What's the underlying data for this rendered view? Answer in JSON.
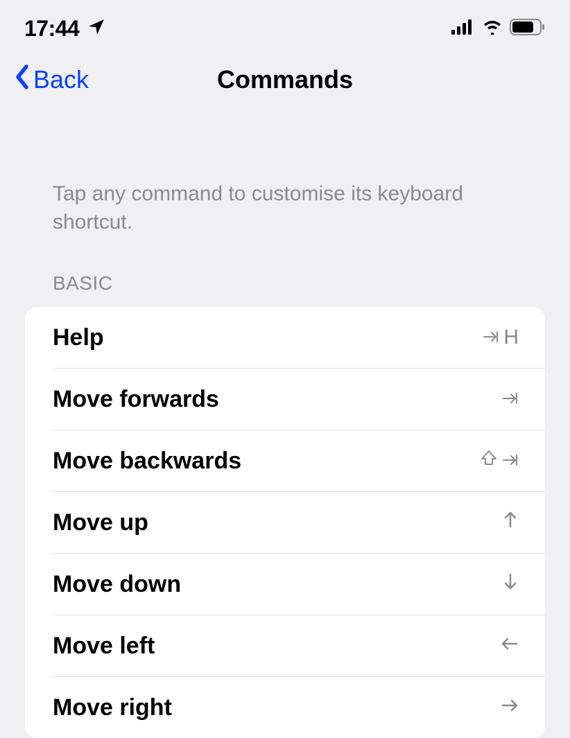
{
  "statusBar": {
    "time": "17:44"
  },
  "nav": {
    "backLabel": "Back",
    "title": "Commands"
  },
  "description": "Tap any command to customise its keyboard shortcut.",
  "sections": [
    {
      "header": "BASIC",
      "items": [
        {
          "label": "Help",
          "shortcut": "⇥ H",
          "shortcutType": "tab-h"
        },
        {
          "label": "Move forwards",
          "shortcut": "⇥",
          "shortcutType": "tab"
        },
        {
          "label": "Move backwards",
          "shortcut": "⇧ ⇥",
          "shortcutType": "shift-tab"
        },
        {
          "label": "Move up",
          "shortcut": "↑",
          "shortcutType": "arrow-up"
        },
        {
          "label": "Move down",
          "shortcut": "↓",
          "shortcutType": "arrow-down"
        },
        {
          "label": "Move left",
          "shortcut": "←",
          "shortcutType": "arrow-left"
        },
        {
          "label": "Move right",
          "shortcut": "→",
          "shortcutType": "arrow-right"
        }
      ]
    }
  ]
}
